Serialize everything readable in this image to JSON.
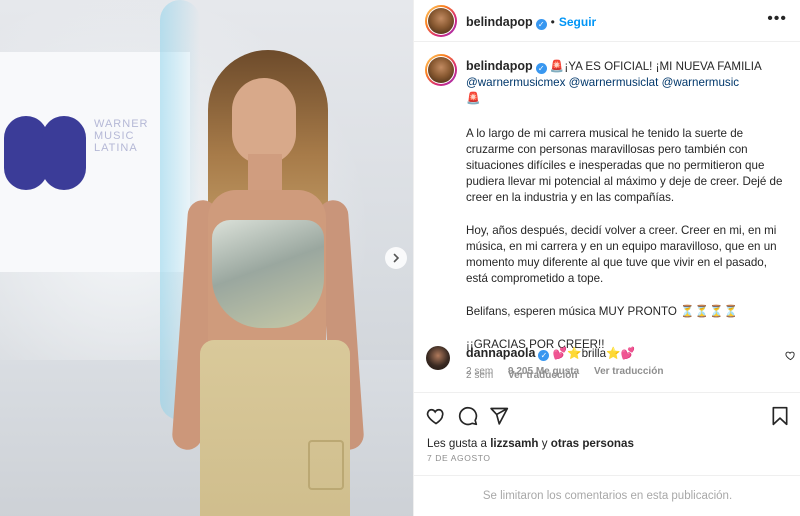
{
  "photo": {
    "logo_lines": [
      "WARNER",
      "MUSIC",
      "LATINA"
    ],
    "next_icon": "chevron-right-icon"
  },
  "header": {
    "username": "belindapop",
    "follow_label": "Seguir",
    "more_icon": "more-horizontal-icon"
  },
  "caption": {
    "username": "belindapop",
    "headline": "🚨¡YA ES OFICIAL! ¡MI NUEVA FAMILIA",
    "mentions": [
      "@warnermusicmex",
      "@warnermusiclat",
      "@warnermusic"
    ],
    "trailing_emoji": "🚨",
    "paragraph1": "A lo largo de mi carrera musical he tenido la suerte de cruzarme con personas maravillosas pero también con situaciones difíciles e inesperadas que no permitieron que pudiera llevar mi potencial al máximo y deje de creer. Dejé de creer en la industria y en las compañías.",
    "paragraph2": "Hoy, años después, decidí volver a creer. Creer en mi, en mi música, en mi carrera y en un equipo maravilloso, que en un momento muy diferente al que tuve que vivir en el pasado, está comprometido a tope.",
    "paragraph3": "Belifans, esperen música MUY PRONTO ⏳⏳⏳⏳",
    "paragraph4": "¡¡GRACIAS POR CREER!!",
    "time": "2 sem",
    "see_translation": "Ver traducción"
  },
  "comment": {
    "username": "dannapaola",
    "text": "💕⭐brilla⭐💕",
    "time": "2 sem",
    "likes": "9,205 Me gusta",
    "see_translation": "Ver traducción"
  },
  "actions": {
    "like_icon": "heart-icon",
    "comment_icon": "comment-icon",
    "share_icon": "send-icon",
    "save_icon": "bookmark-icon",
    "likes_prefix": "Les gusta a",
    "likes_user": "lizzsamh",
    "likes_join": "y",
    "likes_others": "otras personas",
    "date": "7 DE AGOSTO"
  },
  "footer": {
    "comments_limited": "Se limitaron los comentarios en esta publicación."
  }
}
